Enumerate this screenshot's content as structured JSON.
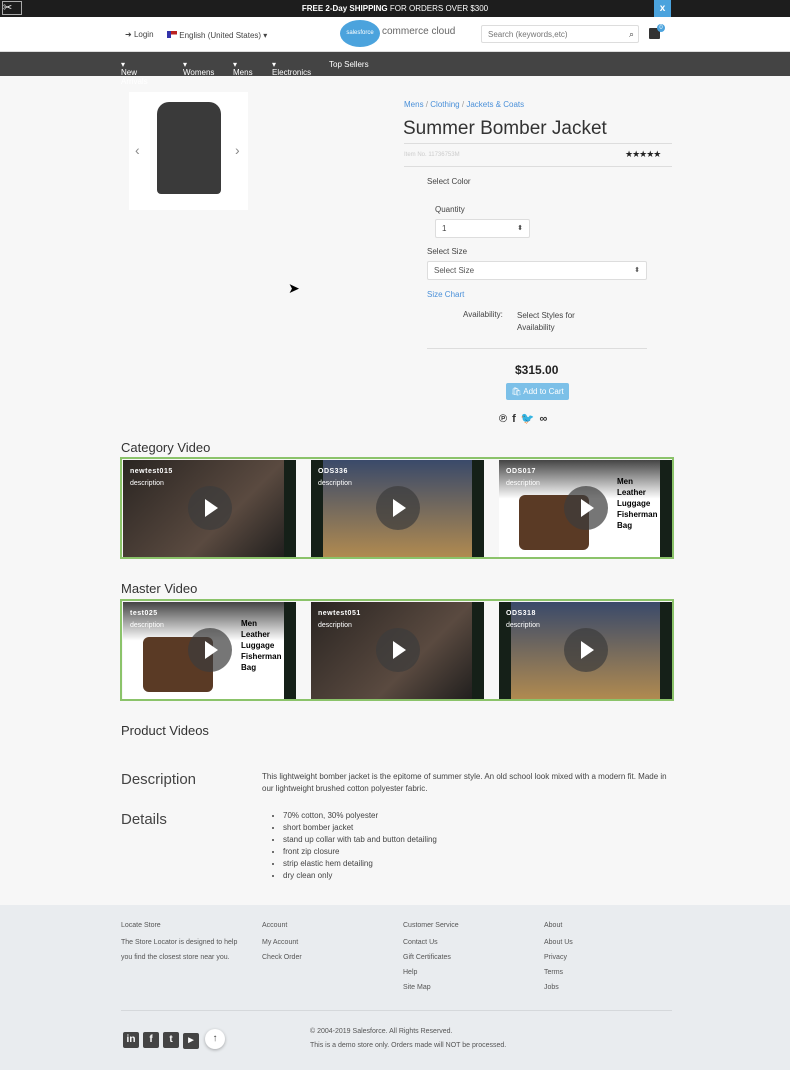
{
  "promo": {
    "bold": "FREE 2-Day SHIPPING",
    "rest": " FOR ORDERS OVER $300",
    "close": "x"
  },
  "header": {
    "login": "Login",
    "language": "English (United States)",
    "logo_badge": "salesforce",
    "logo_text": "commerce cloud",
    "search_placeholder": "Search (keywords,etc)",
    "cart_count": "0"
  },
  "nav": [
    "New Arrivals",
    "Womens",
    "Mens",
    "Electronics",
    "Top Sellers"
  ],
  "breadcrumb": [
    "Mens",
    "Clothing",
    "Jackets & Coats"
  ],
  "product": {
    "title": "Summer Bomber Jacket",
    "item_no": "Item No. 11736753M",
    "rating": 5,
    "stars": "★★★★★",
    "select_color": "Select Color",
    "quantity_label": "Quantity",
    "quantity": "1",
    "size_label": "Select Size",
    "size_value": "Select Size",
    "size_chart": "Size Chart",
    "availability_label": "Availability:",
    "availability_value": "Select Styles for Availability",
    "price": "$315.00",
    "add_to_cart": "Add to Cart"
  },
  "category_video": {
    "title": "Category Video",
    "items": [
      {
        "name": "newtest015",
        "desc": "description"
      },
      {
        "name": "ODS336",
        "desc": "description"
      },
      {
        "name": "ODS017",
        "desc": "description",
        "overlay": "Men Leather Luggage Fisherman Bag"
      }
    ]
  },
  "master_video": {
    "title": "Master Video",
    "items": [
      {
        "name": "test025",
        "desc": "description",
        "overlay": "Men Leather Luggage Fisherman Bag"
      },
      {
        "name": "newtest051",
        "desc": "description"
      },
      {
        "name": "ODS318",
        "desc": "description"
      }
    ]
  },
  "product_videos": "Product Videos",
  "description": {
    "title": "Description",
    "text": "This lightweight bomber jacket is the epitome of summer style. An old school look mixed with a modern fit. Made in our lightweight brushed cotton polyester fabric."
  },
  "details": {
    "title": "Details",
    "items": [
      "70% cotton, 30% polyester",
      "short bomber jacket",
      "stand up collar with tab and button detailing",
      "front zip closure",
      "strip elastic hem detailing",
      "dry clean only"
    ]
  },
  "footer": {
    "locate": {
      "title": "Locate Store",
      "text": "The Store Locator is designed to help you find the closest store near you."
    },
    "account": {
      "title": "Account",
      "links": [
        "My Account",
        "Check Order"
      ]
    },
    "customer": {
      "title": "Customer Service",
      "links": [
        "Contact Us",
        "Gift Certificates",
        "Help",
        "Site Map"
      ]
    },
    "about": {
      "title": "About",
      "links": [
        "About Us",
        "Privacy",
        "Terms",
        "Jobs"
      ]
    },
    "copyright": "© 2004-2019 Salesforce. All Rights Reserved.",
    "demo": "This is a demo store only. Orders made will NOT be processed."
  },
  "colors": {
    "accent": "#4a90d9",
    "video_border": "#8bc36a",
    "button": "#7cc0e8"
  }
}
